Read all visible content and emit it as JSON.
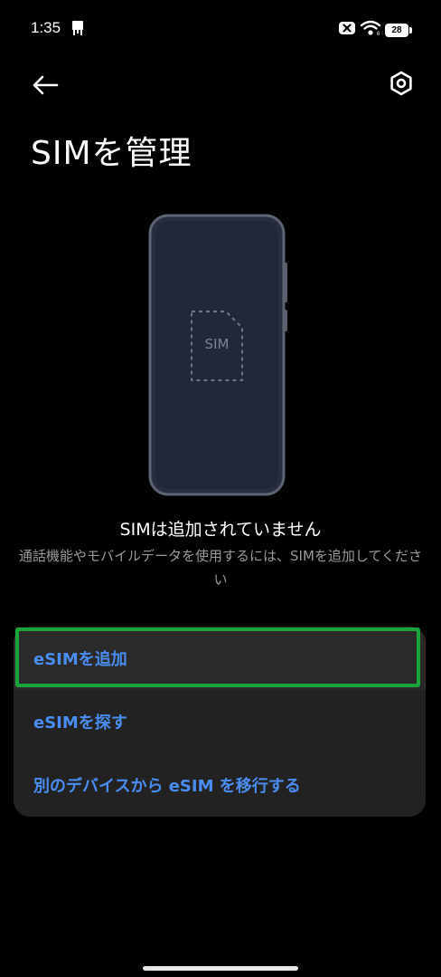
{
  "status_bar": {
    "time": "1:35",
    "battery": "28",
    "notification_icon": "phone-slot-icon",
    "signal_icons": [
      "no-sim-icon",
      "wifi-icon"
    ]
  },
  "header": {
    "back_icon": "arrow-left-icon",
    "settings_icon": "settings-hexagon-icon",
    "title": "SIMを管理"
  },
  "illustration": {
    "sim_label": "SIM"
  },
  "empty_state": {
    "title": "SIMは追加されていません",
    "description": "通話機能やモバイルデータを使用するには、SIMを追加してください"
  },
  "options": [
    {
      "label": "eSIMを追加"
    },
    {
      "label": "eSIMを探す"
    },
    {
      "label": "別のデバイスから eSIM を移行する"
    }
  ],
  "colors": {
    "accent": "#4a8df2",
    "highlight": "#1aa53a",
    "card": "#222222",
    "background": "#000000"
  }
}
